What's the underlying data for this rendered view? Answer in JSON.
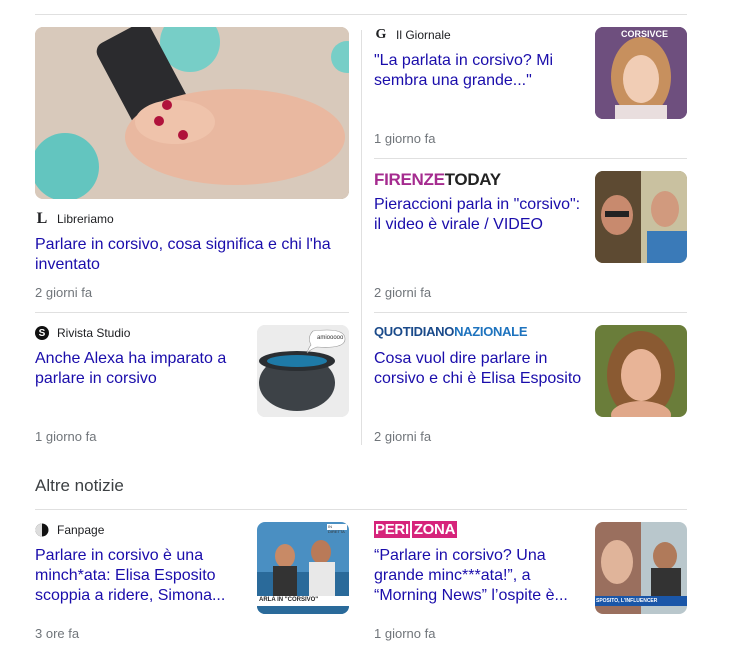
{
  "section": {
    "more_news": "Altre notizie"
  },
  "articles": [
    {
      "source": "Libreriamo",
      "logo": "L",
      "title": "Parlare in corsivo, cosa significa e chi l'ha inventato",
      "time": "2 giorni fa"
    },
    {
      "source": "Il Giornale",
      "logo": "G",
      "title": "\"La parlata in corsivo? Mi sembra una grande...\"",
      "time": "1 giorno fa",
      "thumb_caption": "CORSIVCE"
    },
    {
      "source": "FIRENZETODAY",
      "source_parts": [
        "FIRENZE",
        "TODAY"
      ],
      "title": "Pieraccioni parla in \"corsivo\": il video è virale / VIDEO",
      "time": "2 giorni fa"
    },
    {
      "source": "Rivista Studio",
      "logo": "S",
      "title": "Anche Alexa ha imparato a parlare in corsivo",
      "time": "1 giorno fa",
      "thumb_caption": "amiooooo"
    },
    {
      "source": "QUOTIDIANONAZIONALE",
      "source_parts": [
        "QUOTIDIANO",
        "NAZIONALE"
      ],
      "title": "Cosa vuol dire parlare in corsivo e chi è Elisa Esposito",
      "time": "2 giorni fa"
    },
    {
      "source": "Fanpage",
      "title": "Parlare in corsivo è una minch*ata: Elisa Esposito scoppia a ridere, Simona...",
      "time": "3 ore fa",
      "thumb_caption": "ARLA IN \"CORSIVO\"",
      "thumb_top": "IN DIRETTA"
    },
    {
      "source": "PERIZONA",
      "source_parts": [
        "PERI",
        "ZONA"
      ],
      "title": "“Parlare in corsivo? Una grande minc***ata!”, a “Morning News” l’ospite è...",
      "time": "1 giorno fa",
      "thumb_caption": "SPOSITO, L'INFLUENCER"
    }
  ],
  "colors": {
    "link": "#1a0dab",
    "meta": "#70757a",
    "firenze_purple": "#a52b8f",
    "qn_blue": "#1e73be",
    "perizona_pink": "#d6247b"
  }
}
